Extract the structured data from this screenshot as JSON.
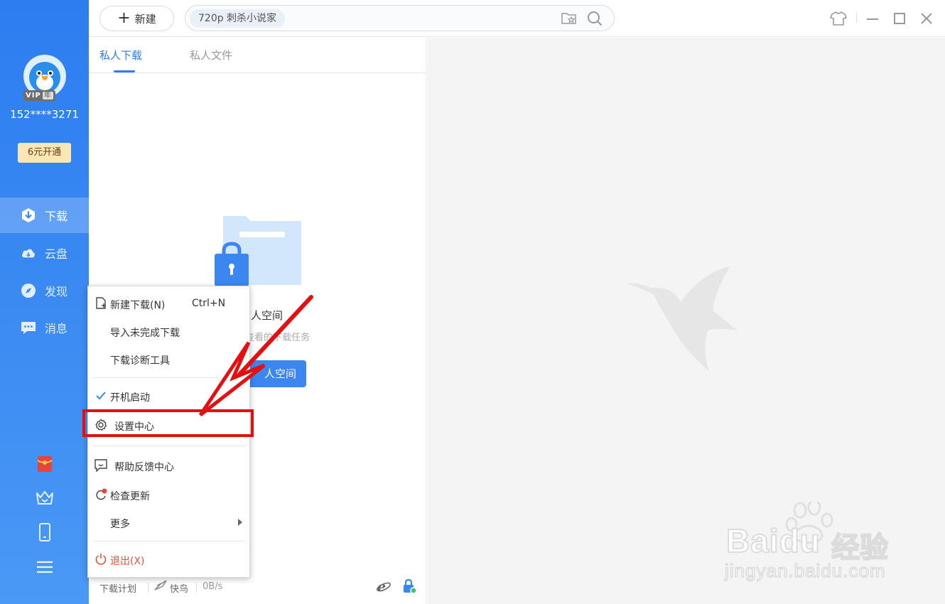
{
  "user": {
    "vip_label": "VIP",
    "vip_year": "年",
    "username": "152****3271",
    "vip_open_button": "6元开通"
  },
  "nav": [
    {
      "label": "下载",
      "icon": "download-icon",
      "active": true
    },
    {
      "label": "云盘",
      "icon": "cloud-icon",
      "active": false
    },
    {
      "label": "发现",
      "icon": "compass-icon",
      "active": false
    },
    {
      "label": "消息",
      "icon": "message-icon",
      "active": false
    }
  ],
  "bottom_icons": [
    "red-packet-icon",
    "crown-icon",
    "phone-icon",
    "menu-icon"
  ],
  "toolbar": {
    "new_label": "新建",
    "search_tag": "720p  刺杀小说家"
  },
  "tabs": [
    {
      "label": "私人下载",
      "active": true
    },
    {
      "label": "私人文件",
      "active": false
    }
  ],
  "empty_state": {
    "title": "人空间",
    "subtitle": "查看的下载任务",
    "button": "人空间"
  },
  "statusbar": {
    "plan": "下载计划",
    "kuainiao": "快鸟",
    "speed": "0B/s"
  },
  "menu": {
    "items": [
      {
        "label": "新建下载(N)",
        "shortcut": "Ctrl+N",
        "icon": "new-file-icon"
      },
      {
        "label": "导入未完成下载"
      },
      {
        "label": "下载诊断工具"
      },
      {
        "label": "开机启动",
        "icon": "check-icon"
      },
      {
        "label": "设置中心",
        "icon": "gear-icon"
      },
      {
        "label": "帮助反馈中心",
        "icon": "feedback-icon"
      },
      {
        "label": "检查更新",
        "icon": "update-icon"
      },
      {
        "label": "更多",
        "submenu": true
      },
      {
        "label": "退出(X)",
        "icon": "power-icon"
      }
    ]
  },
  "watermark": {
    "brand": "Baidu",
    "brand_cn": "经验",
    "url": "jingyan.baidu.com"
  },
  "colors": {
    "sidebar": "#2c7df0",
    "accent": "#2f7cf0",
    "highlight": "#e30f10",
    "vip_gold": "#fbe6b6"
  }
}
